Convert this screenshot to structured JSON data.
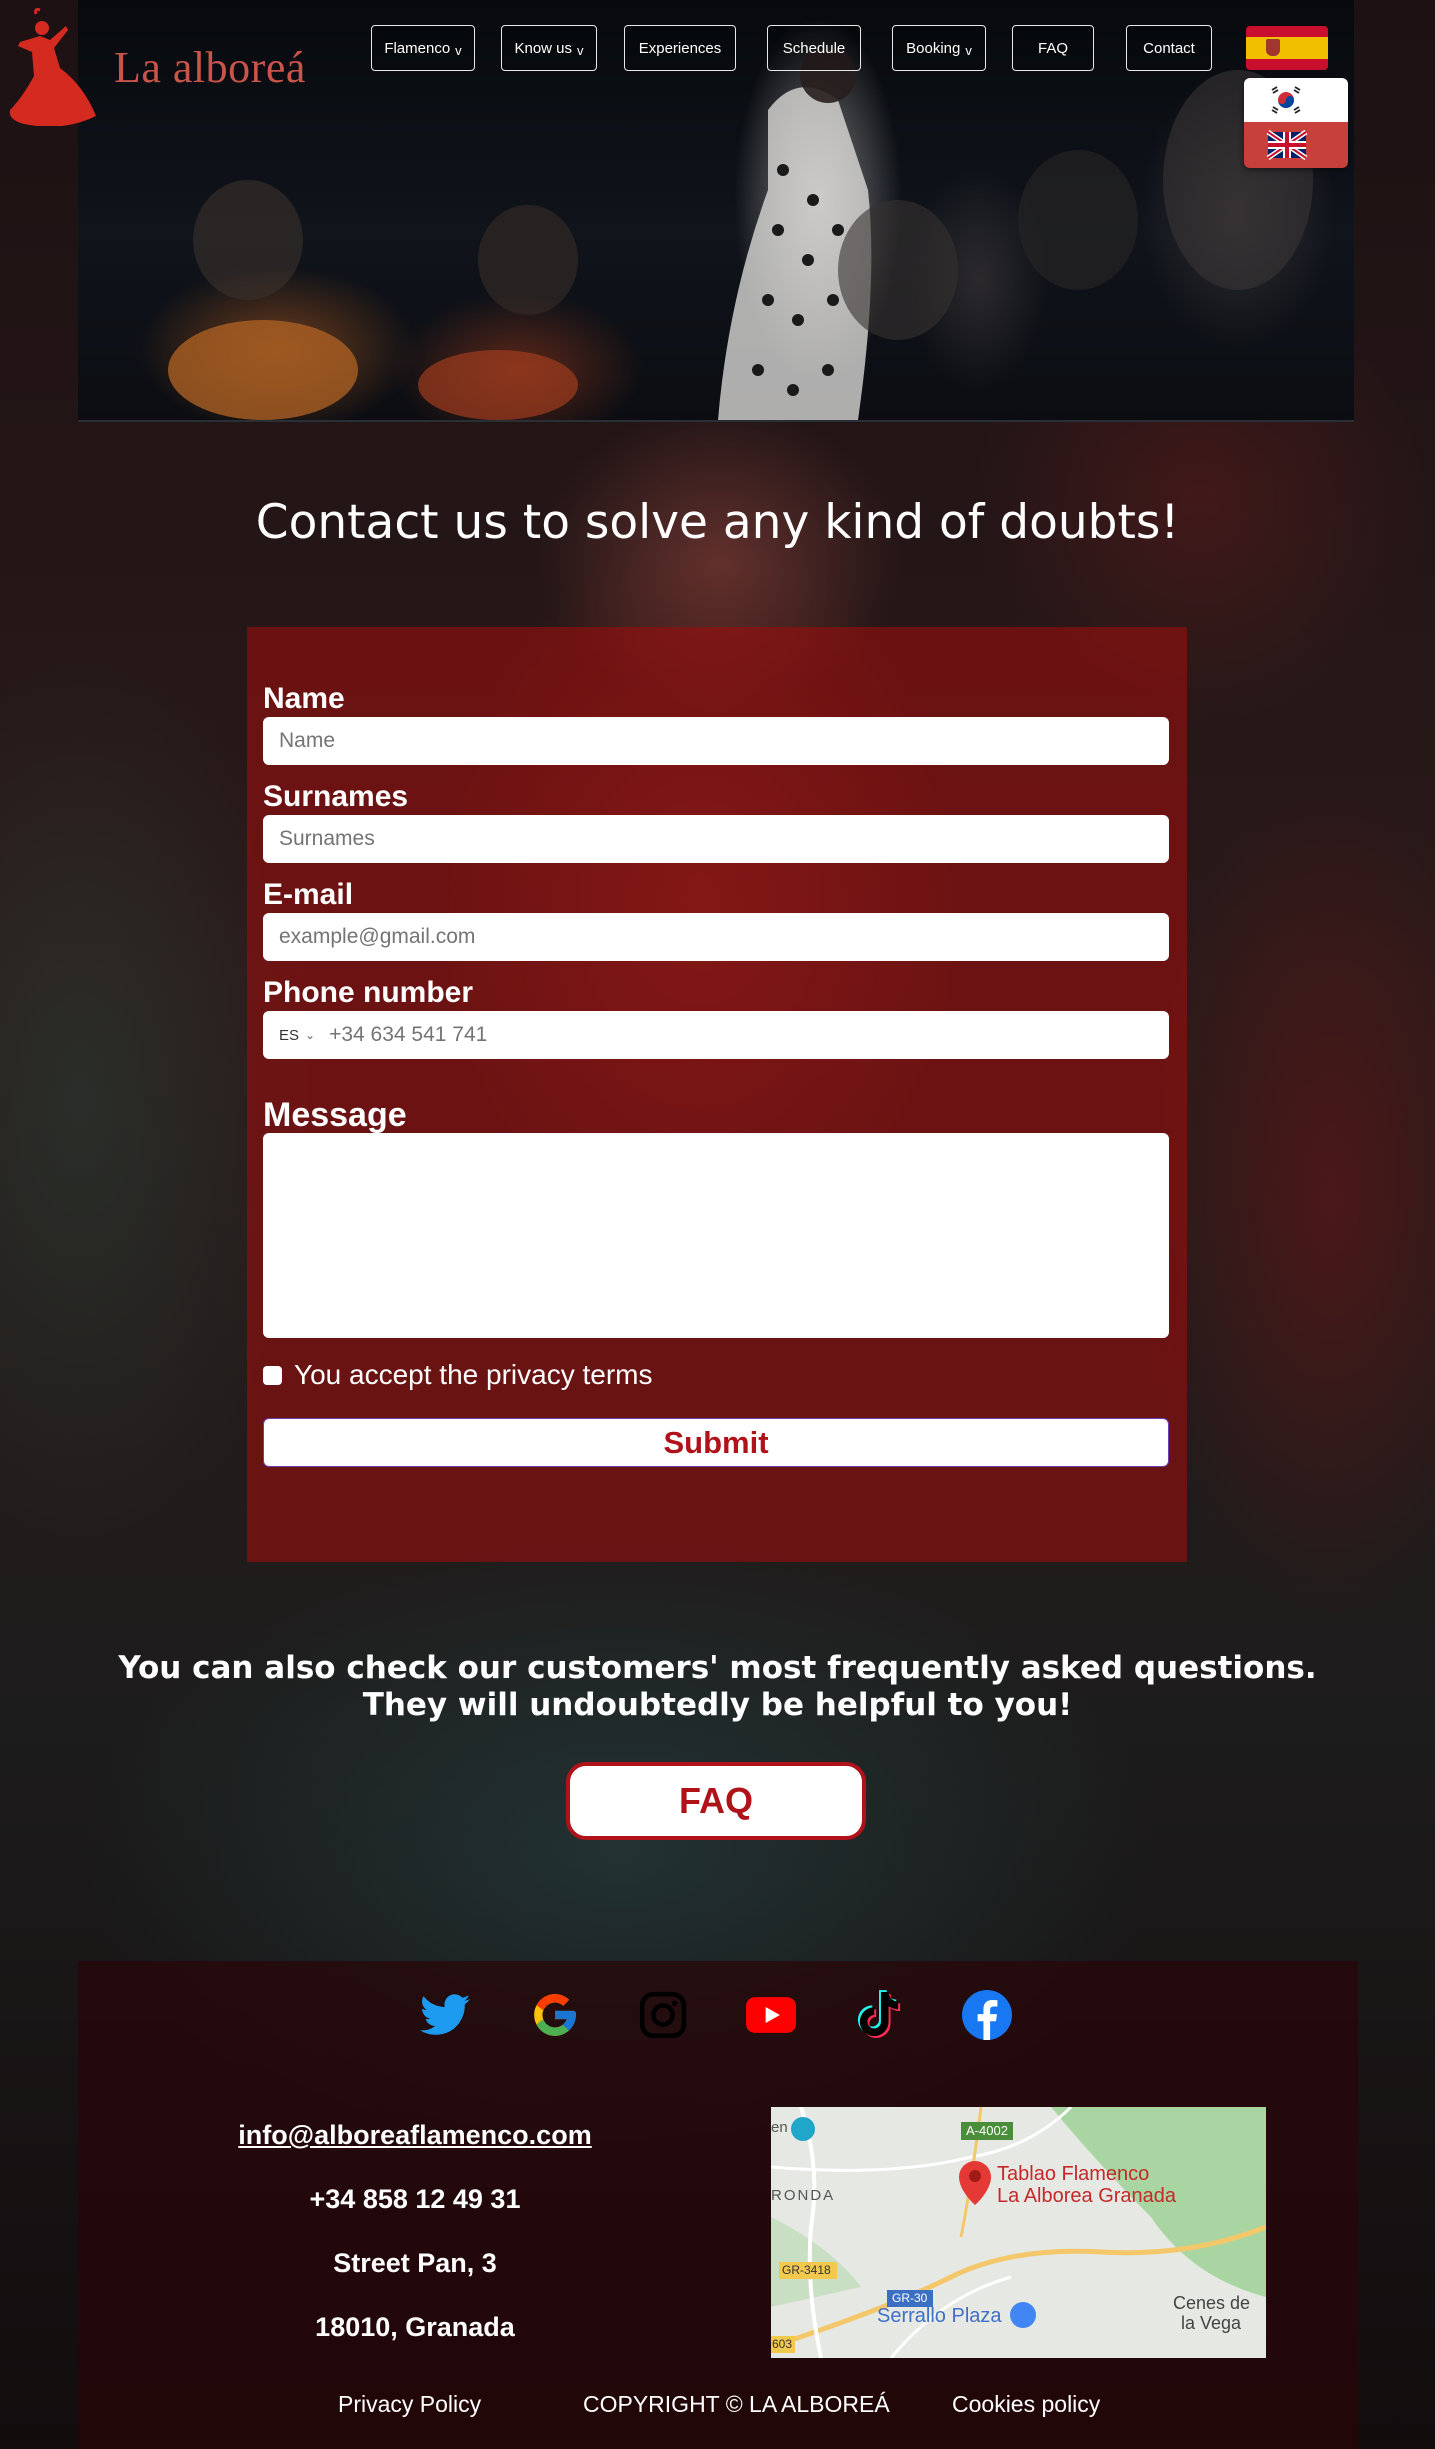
{
  "brand": {
    "name": "La alboreá"
  },
  "nav": {
    "items": [
      {
        "label": "Flamenco",
        "has_dropdown": true
      },
      {
        "label": "Know us",
        "has_dropdown": true
      },
      {
        "label": "Experiences",
        "has_dropdown": false
      },
      {
        "label": "Schedule",
        "has_dropdown": false
      },
      {
        "label": "Booking",
        "has_dropdown": true
      },
      {
        "label": "FAQ",
        "has_dropdown": false
      },
      {
        "label": "Contact",
        "has_dropdown": false
      }
    ],
    "dropdown_chevron": "v"
  },
  "languages": {
    "current": "spain-flag-icon",
    "options": [
      "south-korea-flag-icon",
      "uk-flag-icon"
    ]
  },
  "contact": {
    "title": "Contact us to solve any kind of doubts!",
    "form": {
      "name_label": "Name",
      "name_placeholder": "Name",
      "surnames_label": "Surnames",
      "surnames_placeholder": "Surnames",
      "email_label": "E-mail",
      "email_placeholder": "example@gmail.com",
      "phone_label": "Phone number",
      "phone_country": "ES",
      "phone_placeholder": "+34 634 541 741",
      "message_label": "Message",
      "privacy_text": "You accept the privacy terms",
      "submit_label": "Submit"
    }
  },
  "faq_promo": {
    "line1": "You can also check our customers' most frequently asked questions.",
    "line2": "They will undoubtedly be helpful to you!",
    "button_label": "FAQ"
  },
  "footer": {
    "social_icons": [
      "twitter-icon",
      "google-icon",
      "instagram-icon",
      "youtube-icon",
      "tiktok-icon",
      "facebook-icon"
    ],
    "email": "info@alboreaflamenco.com",
    "phone": "+34 858 12 49 31",
    "street": "Street Pan, 3",
    "city": "18010, Granada",
    "map": {
      "place_name_line1": "Tablao Flamenco",
      "place_name_line2": "La Alborea Granada",
      "labels": [
        "A-4002",
        "RONDA",
        "GR-3418",
        "GR-30",
        "Serrallo Plaza",
        "Cenes de",
        "la Vega",
        "en",
        "603"
      ]
    },
    "privacy_link": "Privacy Policy",
    "copyright": "COPYRIGHT © LA ALBOREÁ",
    "cookies_link": "Cookies policy"
  },
  "colors": {
    "brand_red": "#b0121a",
    "logo_text": "#c9544a",
    "form_panel": "#960e0e"
  }
}
